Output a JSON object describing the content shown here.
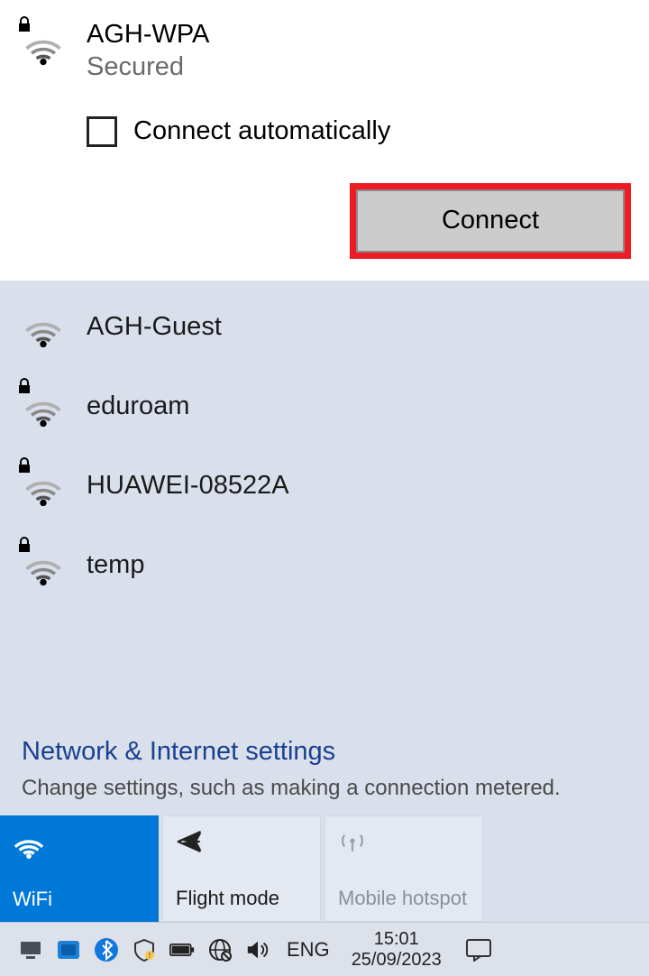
{
  "selected": {
    "name": "AGH-WPA",
    "status": "Secured",
    "secured": true,
    "auto_label": "Connect automatically",
    "connect_label": "Connect"
  },
  "networks": [
    {
      "name": "AGH-Guest",
      "secured": false
    },
    {
      "name": "eduroam",
      "secured": true
    },
    {
      "name": "HUAWEI-08522A",
      "secured": true
    },
    {
      "name": "temp",
      "secured": true
    }
  ],
  "settings_link": "Network & Internet settings",
  "settings_desc": "Change settings, such as making a connection metered.",
  "tiles": {
    "wifi": "WiFi",
    "flight": "Flight mode",
    "hotspot": "Mobile hotspot"
  },
  "tray": {
    "lang": "ENG",
    "time": "15:01",
    "date": "25/09/2023"
  }
}
